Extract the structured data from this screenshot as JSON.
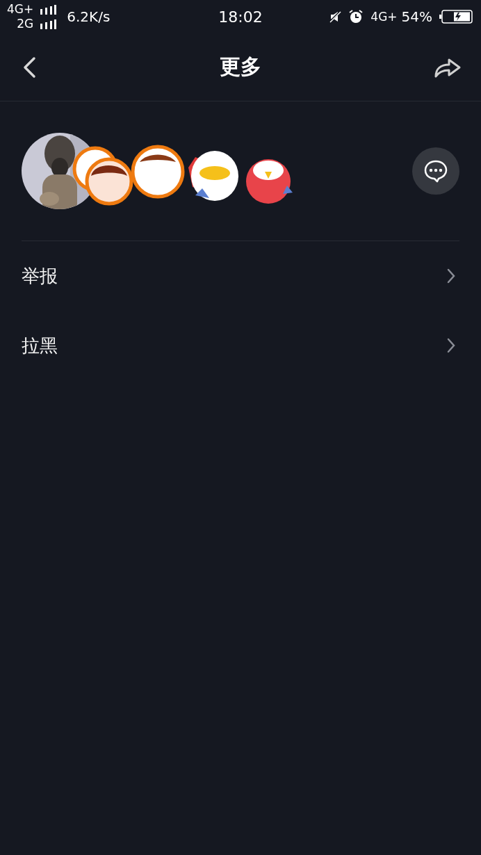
{
  "status_bar": {
    "network_top": "4G+",
    "network_bottom": "2G",
    "speed": "6.2K/s",
    "time": "18:02",
    "network_right": "4G+",
    "battery": "54%"
  },
  "nav": {
    "title": "更多"
  },
  "menu": [
    {
      "label": "举报"
    },
    {
      "label": "拉黑"
    }
  ]
}
